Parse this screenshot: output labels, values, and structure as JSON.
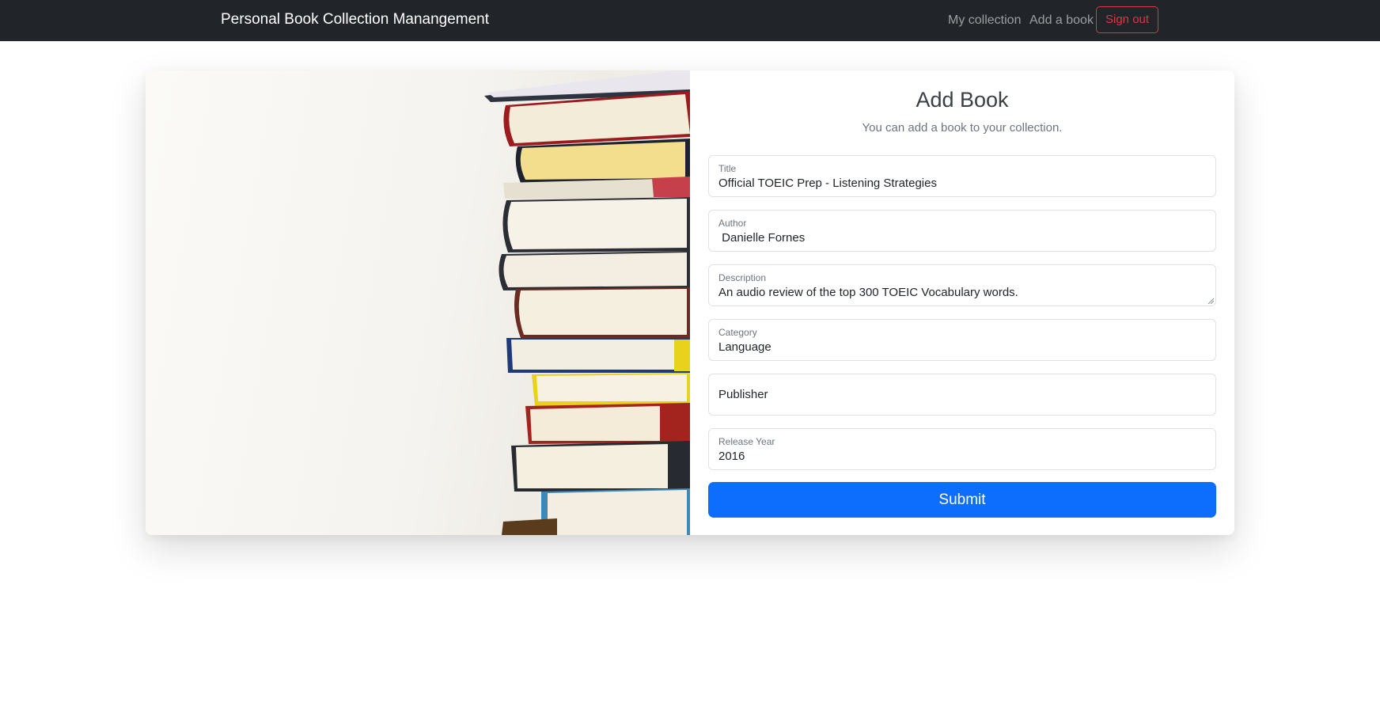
{
  "navbar": {
    "brand": "Personal Book Collection Manangement",
    "links": [
      "My collection",
      "Add a book"
    ],
    "sign_out_label": "Sign out",
    "background": "#212529"
  },
  "form": {
    "title": "Add Book",
    "subtitle": "You can add a book to your collection.",
    "fields": {
      "title": {
        "label": "Title",
        "value": "Official TOEIC Prep - Listening Strategies"
      },
      "author": {
        "label": "Author",
        "value": " Danielle Fornes"
      },
      "description": {
        "label": "Description",
        "value": "An audio review of the top 300 TOEIC Vocabulary words."
      },
      "category": {
        "label": "Category",
        "value": "Language"
      },
      "publisher": {
        "placeholder": "Publisher",
        "value": ""
      },
      "release_year": {
        "label": "Release Year",
        "value": "2016"
      }
    },
    "submit_label": "Submit",
    "accent_color": "#0d6efd"
  },
  "colors": {
    "danger": "#dc3545",
    "muted": "#6c757d"
  }
}
